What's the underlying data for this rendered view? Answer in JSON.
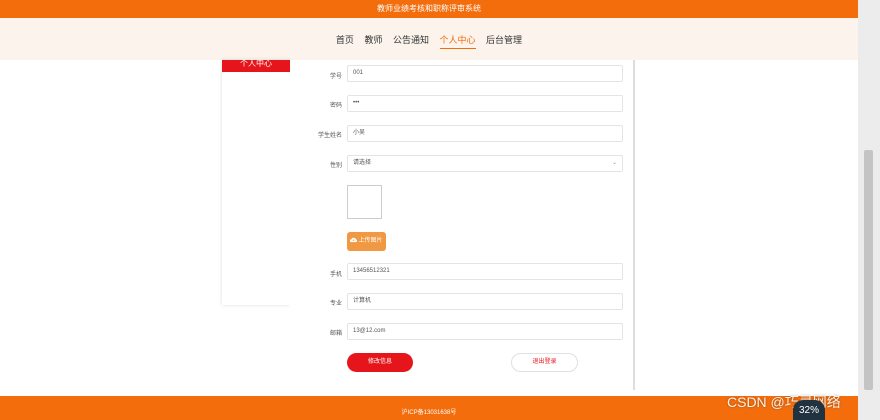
{
  "header": {
    "title": "教师业绩考核和职称评审系统"
  },
  "nav": {
    "items": [
      "首页",
      "教师",
      "公告通知",
      "个人中心",
      "后台管理"
    ],
    "active": "个人中心"
  },
  "sidebar": {
    "title": "个人中心"
  },
  "form": {
    "username_label": "学号",
    "username_value": "001",
    "password_label": "密码",
    "password_value": "•••",
    "name_label": "学生姓名",
    "name_value": "小吴",
    "gender_label": "性别",
    "gender_placeholder": "请选择",
    "upload_label": "上传图片",
    "phone_label": "手机",
    "phone_value": "13456512321",
    "major_label": "专业",
    "major_value": "计算机",
    "email_label": "邮箱",
    "email_value": "13@12.com"
  },
  "actions": {
    "update_label": "修改信息",
    "logout_label": "退出登录"
  },
  "footer": {
    "icp": "沪ICP备13031638号"
  },
  "overlay": {
    "watermark": "CSDN @巧灵网络",
    "meter": "32%"
  },
  "colors": {
    "primary": "#f36d0c",
    "accent": "#e6151b",
    "upload": "#f09842"
  }
}
